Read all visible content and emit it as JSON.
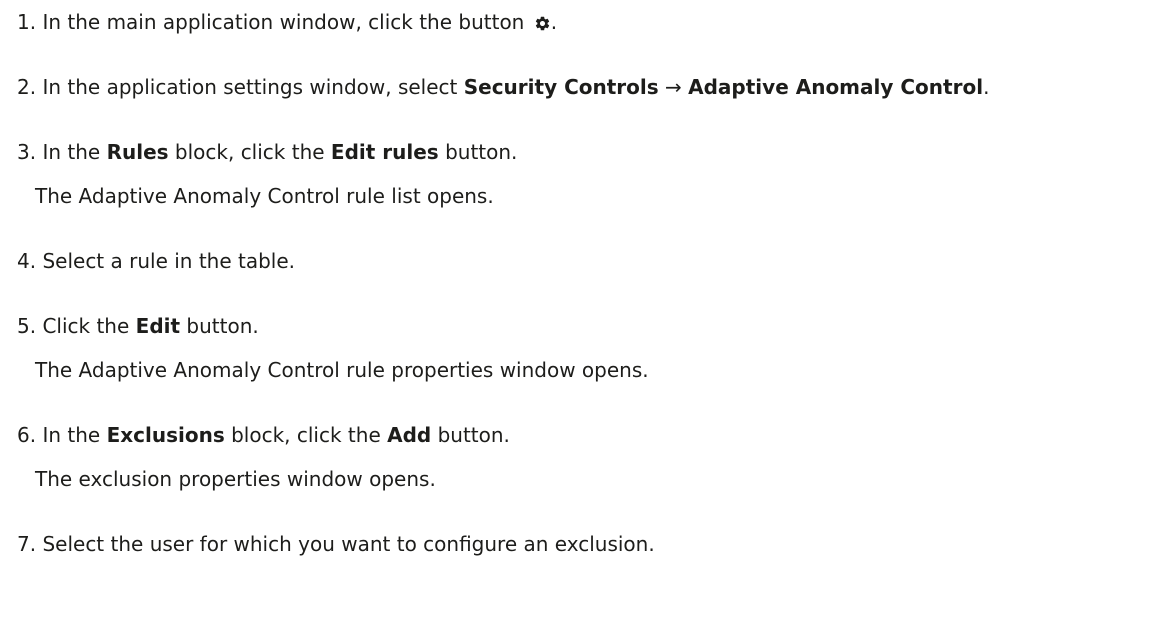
{
  "steps": [
    {
      "number": "1.",
      "text_a": "In the main application window, click the button",
      "icon": "gear-icon",
      "text_b": "."
    },
    {
      "number": "2.",
      "text_a": "In the application settings window, select",
      "bold_a": "Security Controls",
      "arrow": "→",
      "bold_b": "Adaptive Anomaly Control",
      "text_b": "."
    },
    {
      "number": "3.",
      "text_a": "In the",
      "bold_a": "Rules",
      "text_b": "block, click the",
      "bold_b": "Edit rules",
      "text_c": "button.",
      "note": "The Adaptive Anomaly Control rule list opens."
    },
    {
      "number": "4.",
      "text_a": "Select a rule in the table."
    },
    {
      "number": "5.",
      "text_a": "Click the",
      "bold_a": "Edit",
      "text_b": "button.",
      "note": "The Adaptive Anomaly Control rule properties window opens."
    },
    {
      "number": "6.",
      "text_a": "In the",
      "bold_a": "Exclusions",
      "text_b": "block, click the",
      "bold_b": "Add",
      "text_c": "button.",
      "note": "The exclusion properties window opens."
    },
    {
      "number": "7.",
      "text_a": "Select the user for which you want to configure an exclusion."
    }
  ]
}
